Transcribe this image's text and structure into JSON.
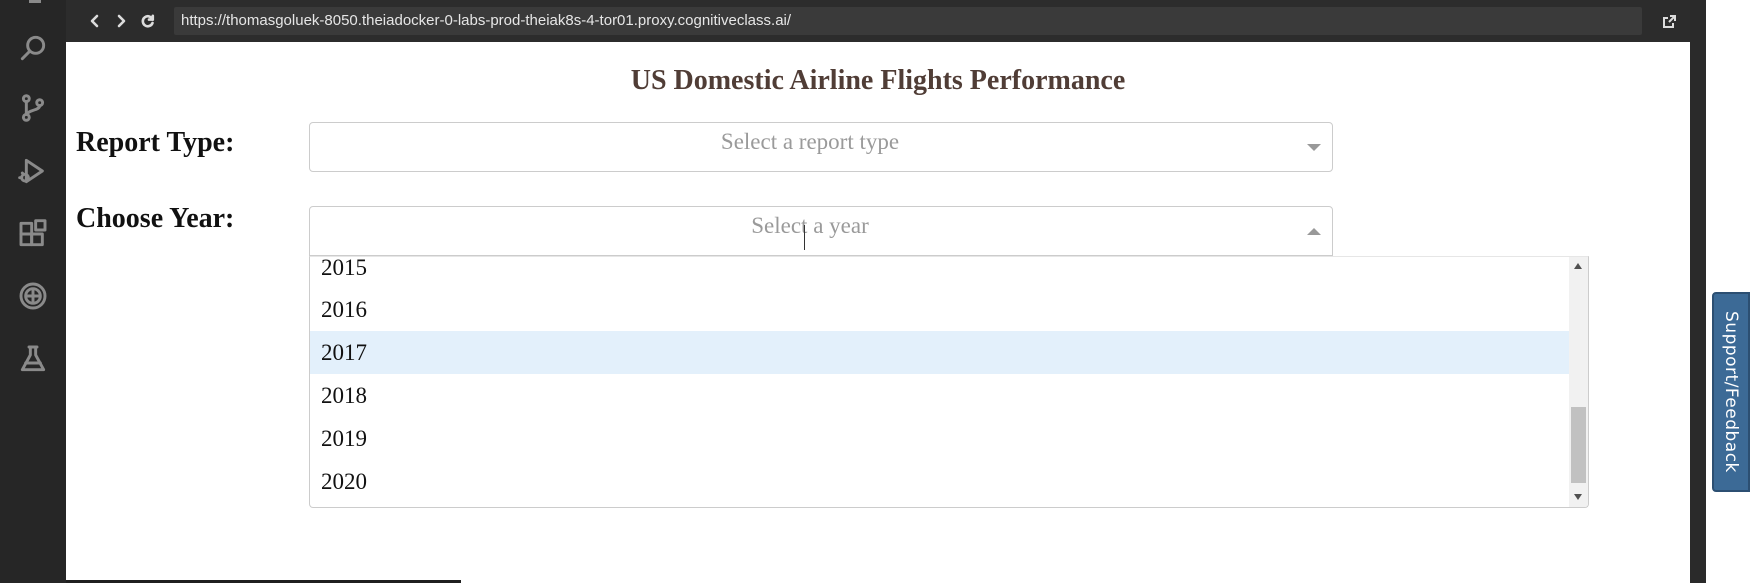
{
  "browser": {
    "url": "https://thomasgoluek-8050.theiadocker-0-labs-prod-theiak8s-4-tor01.proxy.cognitiveclass.ai/"
  },
  "activity_bar": {
    "icons": [
      "search-icon",
      "source-control-icon",
      "run-debug-icon",
      "extensions-icon",
      "skills-network-icon",
      "lab-flask-icon"
    ]
  },
  "support_tab": {
    "label": "Support/Feedback"
  },
  "page": {
    "title": "US Domestic Airline Flights Performance",
    "report_type": {
      "label": "Report Type:",
      "placeholder": "Select a report type"
    },
    "year": {
      "label": "Choose Year:",
      "placeholder": "Select a year",
      "visible_options": [
        "2015",
        "2016",
        "2017",
        "2018",
        "2019",
        "2020"
      ],
      "focused_option": "2017"
    }
  },
  "colors": {
    "title": "#503d36",
    "option_focus": "#e3f0fb",
    "support_tab": "#3c6a96"
  }
}
